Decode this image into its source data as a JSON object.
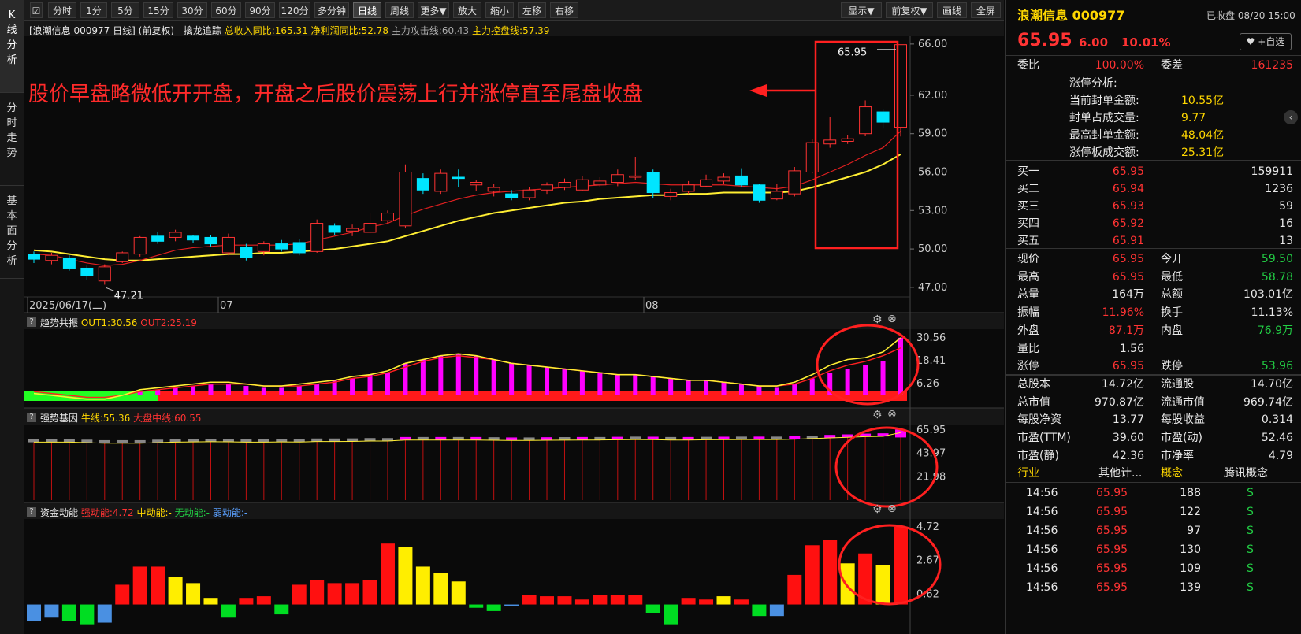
{
  "sidebar": {
    "tabs": [
      {
        "label": "K线分析"
      },
      {
        "label": "分时走势"
      },
      {
        "label": "基本面分析"
      }
    ]
  },
  "toolbar": {
    "left": [
      "分时",
      "1分",
      "5分",
      "15分",
      "30分",
      "60分",
      "90分",
      "120分",
      "多分钟",
      "日线",
      "周线",
      "更多▼",
      "放大",
      "缩小",
      "左移",
      "右移"
    ],
    "right": [
      "显示▼",
      "前复权▼",
      "画线",
      "全屏"
    ],
    "active": "日线"
  },
  "main_chart": {
    "title": "[浪潮信息 000977 日线]",
    "adjust": "(前复权)",
    "indicator_name": "擒龙追踪",
    "ind1": "总收入同比:165.31",
    "ind2": "净利润同比:52.78",
    "ind3": "主力攻击线:60.43",
    "ind4": "主力控盘线:57.39",
    "annotation": "股价早盘略微低开开盘，开盘之后股价震荡上行并涨停直至尾盘收盘",
    "high_label": "65.95",
    "low_label": "47.21",
    "date_labels": [
      "2025/06/17(二)",
      "07",
      "08"
    ],
    "price_ticks": [
      "66.00",
      "62.00",
      "59.00",
      "56.00",
      "53.00",
      "50.00",
      "47.00"
    ]
  },
  "panel_trend": {
    "name": "趋势共振",
    "out1": "OUT1:30.56",
    "out2": "OUT2:25.19",
    "ticks": [
      "30.56",
      "18.41",
      "6.26"
    ]
  },
  "panel_gene": {
    "name": "强势基因",
    "l1": "牛线:55.36",
    "l2": "大盘中线:60.55",
    "ticks": [
      "65.95",
      "43.97",
      "21.98"
    ]
  },
  "panel_fund": {
    "name": "资金动能",
    "l1": "强动能:4.72",
    "l2": "中动能:-",
    "l3": "无动能:-",
    "l4": "弱动能:-",
    "ticks": [
      "4.72",
      "2.67",
      "0.62"
    ]
  },
  "chart_data": {
    "type": "candlestick",
    "title": "浪潮信息 000977 日线",
    "candles": [
      [
        49.6,
        49.2,
        49.8,
        48.9
      ],
      [
        49.1,
        49.5,
        49.7,
        48.8
      ],
      [
        49.3,
        48.5,
        49.5,
        48.3
      ],
      [
        48.5,
        47.9,
        48.7,
        47.6
      ],
      [
        47.5,
        48.6,
        48.8,
        47.21
      ],
      [
        49.0,
        49.7,
        49.8,
        48.9
      ],
      [
        49.6,
        50.9,
        51.0,
        49.4
      ],
      [
        51.0,
        50.6,
        51.3,
        50.4
      ],
      [
        50.9,
        51.3,
        51.5,
        50.6
      ],
      [
        51.0,
        50.7,
        51.1,
        50.5
      ],
      [
        50.9,
        50.4,
        51.1,
        50.2
      ],
      [
        49.7,
        50.9,
        51.2,
        49.5
      ],
      [
        50.1,
        49.3,
        50.4,
        49.1
      ],
      [
        49.8,
        50.4,
        50.6,
        49.5
      ],
      [
        50.4,
        50.0,
        50.7,
        49.8
      ],
      [
        50.5,
        49.7,
        50.8,
        49.5
      ],
      [
        49.8,
        52.0,
        52.3,
        49.7
      ],
      [
        51.8,
        51.3,
        52.0,
        51.1
      ],
      [
        51.4,
        51.6,
        51.9,
        51.0
      ],
      [
        51.3,
        52.0,
        52.8,
        51.2
      ],
      [
        52.2,
        52.8,
        53.0,
        52.0
      ],
      [
        51.8,
        56.0,
        56.6,
        51.6
      ],
      [
        55.5,
        54.6,
        55.9,
        54.3
      ],
      [
        54.5,
        55.9,
        56.2,
        54.3
      ],
      [
        55.6,
        55.5,
        56.2,
        54.8
      ],
      [
        55.0,
        55.2,
        55.4,
        54.5
      ],
      [
        54.5,
        54.8,
        55.1,
        54.1
      ],
      [
        54.3,
        54.0,
        54.6,
        53.8
      ],
      [
        54.0,
        54.6,
        54.8,
        53.8
      ],
      [
        54.6,
        55.0,
        55.2,
        54.3
      ],
      [
        54.8,
        55.2,
        55.5,
        54.6
      ],
      [
        54.6,
        55.4,
        55.7,
        54.5
      ],
      [
        55.0,
        55.3,
        55.6,
        54.8
      ],
      [
        55.2,
        55.8,
        56.2,
        54.9
      ],
      [
        55.6,
        55.7,
        57.2,
        55.4
      ],
      [
        56.0,
        54.4,
        56.2,
        54.0
      ],
      [
        54.1,
        54.4,
        54.7,
        53.8
      ],
      [
        54.5,
        55.0,
        55.3,
        54.3
      ],
      [
        54.9,
        55.4,
        55.8,
        54.8
      ],
      [
        55.3,
        55.6,
        55.9,
        55.1
      ],
      [
        55.7,
        55.0,
        56.3,
        54.8
      ],
      [
        55.0,
        53.8,
        55.1,
        53.6
      ],
      [
        53.9,
        54.5,
        55.1,
        53.8
      ],
      [
        54.3,
        56.1,
        56.4,
        54.1
      ],
      [
        56.0,
        58.3,
        58.6,
        55.9
      ],
      [
        58.2,
        58.5,
        60.3,
        57.9
      ],
      [
        58.4,
        58.6,
        58.9,
        58.2
      ],
      [
        59.0,
        61.1,
        61.6,
        58.8
      ],
      [
        60.7,
        59.9,
        60.9,
        59.4
      ],
      [
        59.5,
        65.95,
        65.95,
        58.78
      ]
    ],
    "ma_short": [
      49.6,
      49.5,
      49.2,
      48.9,
      48.7,
      48.8,
      49.1,
      49.5,
      49.9,
      50.1,
      50.2,
      50.3,
      50.3,
      50.3,
      50.3,
      50.4,
      50.7,
      51.0,
      51.3,
      51.7,
      52.0,
      52.6,
      53.1,
      53.5,
      53.9,
      54.2,
      54.4,
      54.5,
      54.6,
      54.7,
      54.8,
      54.9,
      55.0,
      55.1,
      55.2,
      55.1,
      55.0,
      55.0,
      55.0,
      55.0,
      54.9,
      54.8,
      54.7,
      54.9,
      55.4,
      56.0,
      56.6,
      57.3,
      57.9,
      59.2
    ],
    "ma_long": [
      49.9,
      49.8,
      49.6,
      49.4,
      49.2,
      49.1,
      49.1,
      49.2,
      49.3,
      49.4,
      49.5,
      49.6,
      49.6,
      49.7,
      49.7,
      49.8,
      49.9,
      50.0,
      50.2,
      50.4,
      50.6,
      51.0,
      51.4,
      51.8,
      52.2,
      52.5,
      52.8,
      53.0,
      53.2,
      53.4,
      53.6,
      53.7,
      53.9,
      54.0,
      54.1,
      54.2,
      54.2,
      54.3,
      54.3,
      54.4,
      54.4,
      54.4,
      54.4,
      54.5,
      54.8,
      55.2,
      55.6,
      56.0,
      56.6,
      57.39
    ],
    "price_range": [
      46.5,
      66.3
    ],
    "trend_bars": [
      2,
      1,
      0,
      0,
      0,
      0,
      2,
      3,
      4,
      5,
      6,
      6,
      5,
      4,
      4,
      5,
      6,
      8,
      9,
      11,
      12,
      17,
      19,
      21,
      22,
      21,
      19,
      17,
      16,
      15,
      14,
      13,
      12,
      11,
      11,
      10,
      9,
      8,
      8,
      7,
      6,
      5,
      4,
      6,
      9,
      12,
      14,
      16,
      18,
      30.56
    ],
    "trend_line1": [
      1,
      0,
      -1,
      -2,
      -2,
      0,
      3,
      4,
      5,
      6,
      7,
      7,
      6,
      5,
      5,
      6,
      7,
      8,
      10,
      11,
      13,
      17,
      19,
      21,
      22,
      21,
      19,
      17,
      16,
      15,
      14,
      13,
      12,
      11,
      11,
      10,
      9,
      8,
      8,
      7,
      6,
      5,
      5,
      7,
      11,
      16,
      19,
      20,
      23,
      30.56
    ],
    "trend_line2": [
      2,
      1,
      0,
      -1,
      -1,
      0,
      2,
      3,
      4,
      5,
      6,
      6,
      6,
      5,
      5,
      5,
      6,
      7,
      9,
      10,
      12,
      15,
      18,
      20,
      21,
      20,
      19,
      17,
      16,
      15,
      14,
      13,
      12,
      11,
      11,
      10,
      9,
      8,
      8,
      7,
      6,
      5,
      5,
      6,
      9,
      13,
      16,
      18,
      21,
      25.19
    ],
    "trend_range": [
      0,
      33
    ],
    "gene_values": [
      55,
      55,
      55,
      54.5,
      54,
      54,
      54,
      54.5,
      55,
      55.2,
      55.4,
      55.3,
      55,
      55,
      55.2,
      55.1,
      55.6,
      55.6,
      55.7,
      56,
      56,
      57,
      57,
      57,
      57,
      57,
      56.8,
      56.6,
      56.6,
      56.8,
      56.9,
      57,
      57,
      57.2,
      57.4,
      57.3,
      57,
      57,
      57.2,
      57.3,
      57.4,
      57.4,
      57.4,
      57.8,
      58.3,
      59,
      59.5,
      60.2,
      60.5,
      64
    ],
    "gene_range": [
      0,
      68
    ],
    "fund_values": [
      -1.0,
      -0.8,
      -1.0,
      -1.2,
      -1.1,
      1.2,
      2.3,
      2.3,
      1.7,
      1.3,
      0.4,
      -0.8,
      0.4,
      0.5,
      -0.6,
      1.2,
      1.5,
      1.3,
      1.3,
      1.5,
      3.7,
      3.5,
      2.3,
      1.9,
      1.4,
      -0.2,
      -0.4,
      -0.1,
      0.6,
      0.5,
      0.5,
      0.3,
      0.6,
      0.6,
      0.6,
      -0.5,
      -1.2,
      0.4,
      0.3,
      0.5,
      0.3,
      -0.7,
      -0.7,
      1.8,
      3.6,
      3.9,
      2.5,
      3.1,
      2.4,
      4.72
    ],
    "fund_colors": [
      "blue",
      "blue",
      "green",
      "green",
      "blue",
      "red",
      "red",
      "red",
      "yellow",
      "yellow",
      "yellow",
      "green",
      "red",
      "red",
      "green",
      "red",
      "red",
      "red",
      "red",
      "red",
      "red",
      "yellow",
      "yellow",
      "yellow",
      "yellow",
      "green",
      "green",
      "blue",
      "red",
      "red",
      "red",
      "red",
      "red",
      "red",
      "red",
      "green",
      "green",
      "red",
      "red",
      "yellow",
      "red",
      "green",
      "blue",
      "red",
      "red",
      "red",
      "yellow",
      "red",
      "yellow",
      "red"
    ],
    "fund_range": [
      -1.6,
      5.0
    ]
  },
  "right_panel": {
    "stock_name": "浪潮信息 000977",
    "status": "已收盘 08/20 15:00",
    "price": "65.95",
    "change": "6.00",
    "change_pct": "10.01%",
    "add_watch": "+自选",
    "webi_label": "委比",
    "webi": "100.00%",
    "weicha_label": "委差",
    "weicha": "161235",
    "limit_title": "涨停分析:",
    "limit_rows": [
      {
        "label": "当前封单金额:",
        "value": "10.55亿"
      },
      {
        "label": "封单占成交量:",
        "value": "9.77"
      },
      {
        "label": "最高封单金额:",
        "value": "48.04亿"
      },
      {
        "label": "涨停板成交额:",
        "value": "25.31亿"
      }
    ],
    "bids": [
      {
        "label": "买一",
        "price": "65.95",
        "vol": "159911"
      },
      {
        "label": "买二",
        "price": "65.94",
        "vol": "1236"
      },
      {
        "label": "买三",
        "price": "65.93",
        "vol": "59"
      },
      {
        "label": "买四",
        "price": "65.92",
        "vol": "16"
      },
      {
        "label": "买五",
        "price": "65.91",
        "vol": "13"
      }
    ],
    "quote": [
      [
        {
          "l": "现价",
          "v": "65.95",
          "c": "red"
        },
        {
          "l": "今开",
          "v": "59.50",
          "c": "green"
        }
      ],
      [
        {
          "l": "最高",
          "v": "65.95",
          "c": "red"
        },
        {
          "l": "最低",
          "v": "58.78",
          "c": "green"
        }
      ],
      [
        {
          "l": "总量",
          "v": "164万",
          "c": "white"
        },
        {
          "l": "总额",
          "v": "103.01亿",
          "c": "white"
        }
      ],
      [
        {
          "l": "振幅",
          "v": "11.96%",
          "c": "red"
        },
        {
          "l": "换手",
          "v": "11.13%",
          "c": "white"
        }
      ],
      [
        {
          "l": "外盘",
          "v": "87.1万",
          "c": "red"
        },
        {
          "l": "内盘",
          "v": "76.9万",
          "c": "green"
        }
      ],
      [
        {
          "l": "量比",
          "v": "1.56",
          "c": "white"
        },
        {
          "l": "",
          "v": "",
          "c": "white"
        }
      ],
      [
        {
          "l": "涨停",
          "v": "65.95",
          "c": "red"
        },
        {
          "l": "跌停",
          "v": "53.96",
          "c": "green"
        }
      ],
      [
        {
          "l": "总股本",
          "v": "14.72亿",
          "c": "white"
        },
        {
          "l": "流通股",
          "v": "14.70亿",
          "c": "white"
        }
      ],
      [
        {
          "l": "总市值",
          "v": "970.87亿",
          "c": "white"
        },
        {
          "l": "流通市值",
          "v": "969.74亿",
          "c": "white"
        }
      ],
      [
        {
          "l": "每股净资",
          "v": "13.77",
          "c": "white"
        },
        {
          "l": "每股收益",
          "v": "0.314",
          "c": "white"
        }
      ],
      [
        {
          "l": "市盈(TTM)",
          "v": "39.60",
          "c": "white"
        },
        {
          "l": "市盈(动)",
          "v": "52.46",
          "c": "white"
        }
      ],
      [
        {
          "l": "市盈(静)",
          "v": "42.36",
          "c": "white"
        },
        {
          "l": "市净率",
          "v": "4.79",
          "c": "white"
        }
      ]
    ],
    "industry_label": "行业",
    "industry": "其他计...",
    "concept_label": "概念",
    "concept": "腾讯概念",
    "ticks": [
      {
        "t": "14:56",
        "p": "65.95",
        "v": "188",
        "s": "S"
      },
      {
        "t": "14:56",
        "p": "65.95",
        "v": "122",
        "s": "S"
      },
      {
        "t": "14:56",
        "p": "65.95",
        "v": "97",
        "s": "S"
      },
      {
        "t": "14:56",
        "p": "65.95",
        "v": "130",
        "s": "S"
      },
      {
        "t": "14:56",
        "p": "65.95",
        "v": "109",
        "s": "S"
      },
      {
        "t": "14:56",
        "p": "65.95",
        "v": "139",
        "s": "S"
      }
    ]
  },
  "colors": {
    "up": "#ff3333",
    "down": "#00e5ff",
    "ma_short": "#e02020",
    "ma_long": "#ffee33",
    "magenta": "#ff00ff",
    "highlight": "#ff2020"
  }
}
